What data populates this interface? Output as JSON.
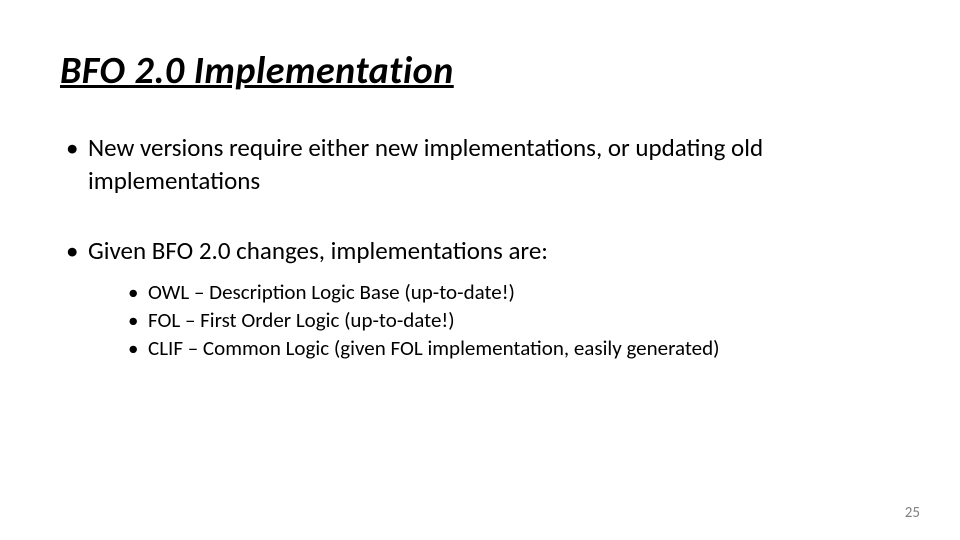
{
  "title": "BFO 2.0 Implementation",
  "bullets": [
    {
      "text": "New versions require either new implementations, or updating old implementations"
    },
    {
      "text": "Given BFO 2.0 changes, implementations are:",
      "sub": [
        "OWL – Description Logic Base (up-to-date!)",
        "FOL – First Order Logic (up-to-date!)",
        "CLIF – Common Logic (given FOL implementation, easily generated)"
      ]
    }
  ],
  "page_number": "25"
}
